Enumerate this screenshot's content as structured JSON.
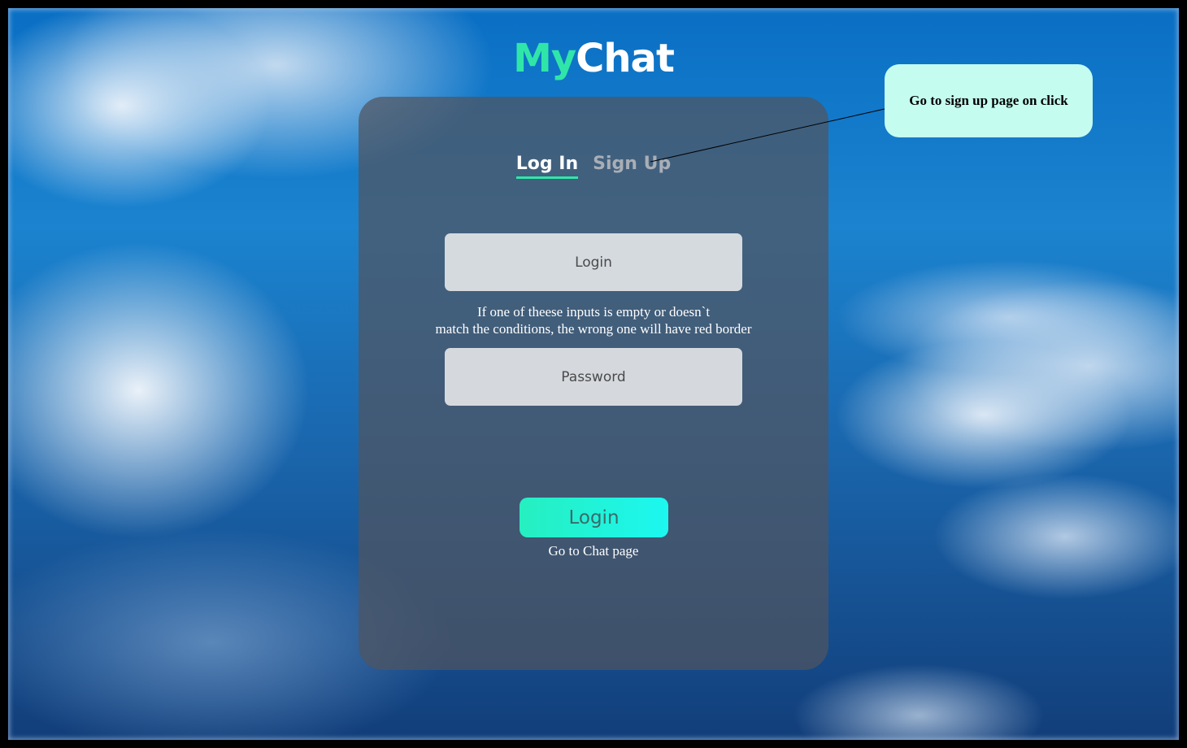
{
  "brand": {
    "part1": "My",
    "part2": "Chat",
    "accent_color": "#2fe6a8"
  },
  "tabs": [
    {
      "label": "Log In",
      "active": true
    },
    {
      "label": "Sign Up",
      "active": false
    }
  ],
  "form": {
    "login_placeholder": "Login",
    "password_placeholder": "Password",
    "note_line1": "If one of theese inputs is empty or doesn`t",
    "note_line2": "match the conditions, the wrong one will have red border",
    "submit_label": "Login",
    "submit_note": "Go to Chat page"
  },
  "annotation": {
    "callout_text": "Go to sign up page on click",
    "callout_color": "#c4fdf0"
  }
}
